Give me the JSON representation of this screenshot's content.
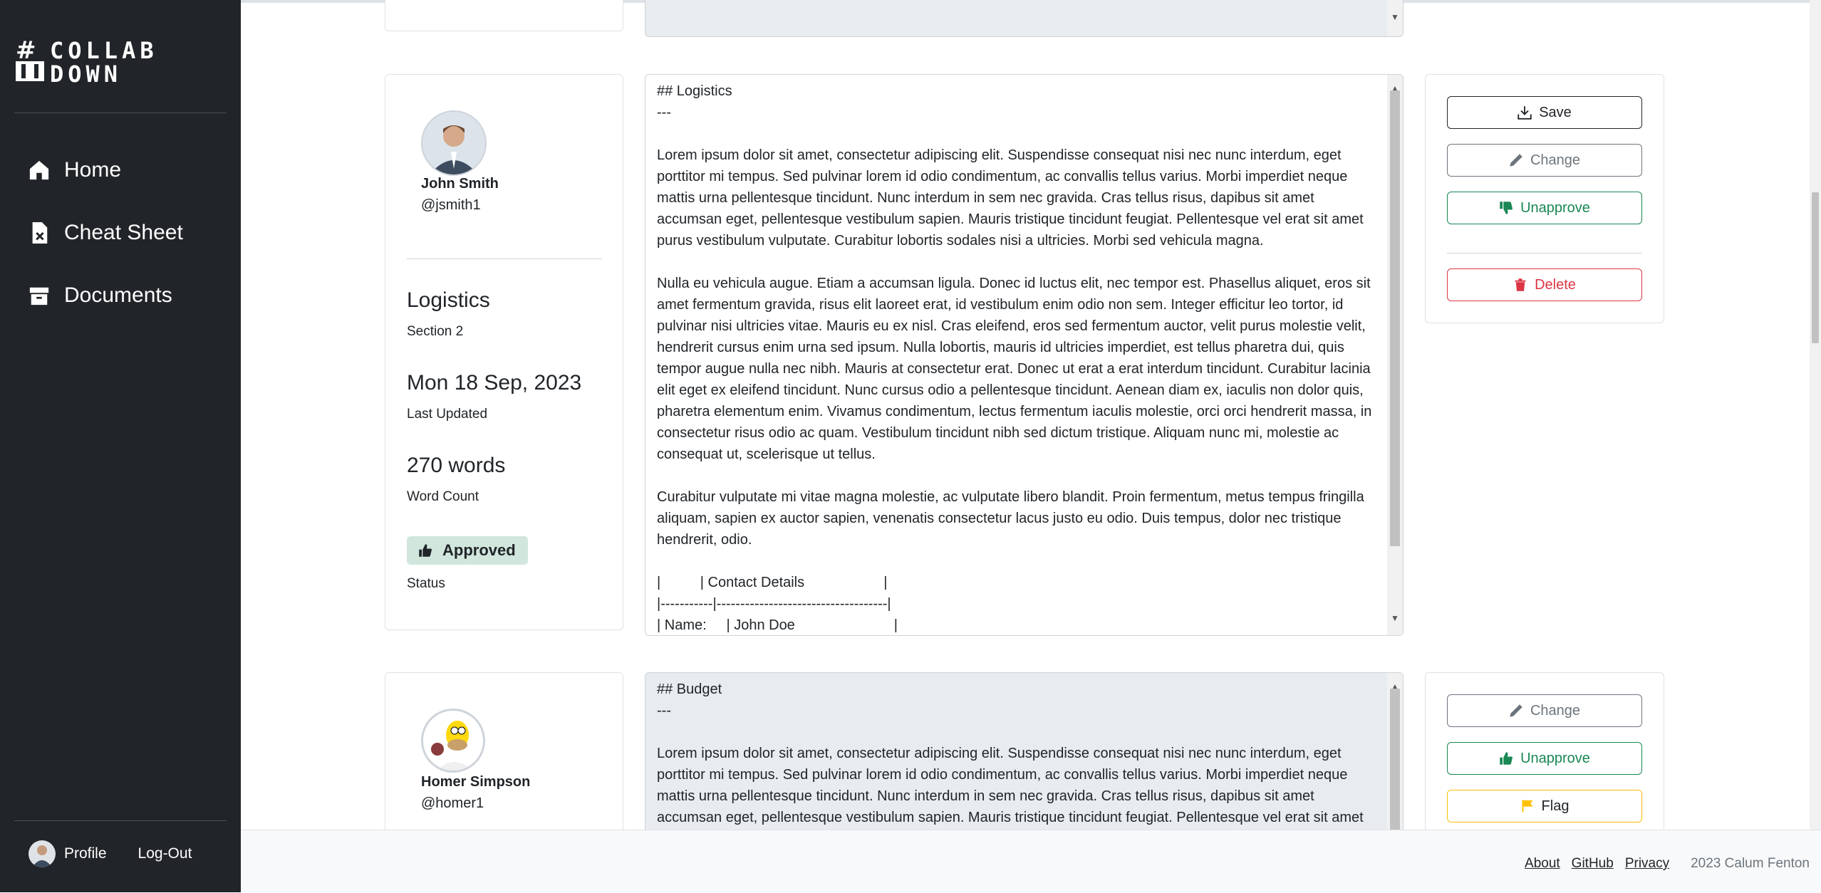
{
  "brand": {
    "logo_text": "#COLLAB DOWN"
  },
  "sidebar": {
    "items": [
      {
        "label": "Home",
        "icon": "home-icon"
      },
      {
        "label": "Cheat Sheet",
        "icon": "file-x-icon"
      },
      {
        "label": "Documents",
        "icon": "archive-icon"
      }
    ],
    "footer": {
      "profile_label": "Profile",
      "logout_label": "Log-Out"
    }
  },
  "sections": [
    {
      "author": {
        "name": "John Smith",
        "handle": "@jsmith1"
      },
      "title": "Logistics",
      "subtitle": "Section 2",
      "date": "Mon 18 Sep, 2023",
      "date_label": "Last Updated",
      "word_count": "270 words",
      "word_count_label": "Word Count",
      "status": "Approved",
      "status_label": "Status",
      "content": "## Logistics\n---\n\nLorem ipsum dolor sit amet, consectetur adipiscing elit. Suspendisse consequat nisi nec nunc interdum, eget porttitor mi tempus. Sed pulvinar lorem id odio condimentum, ac convallis tellus varius. Morbi imperdiet neque mattis urna pellentesque tincidunt. Nunc interdum in sem nec gravida. Cras tellus risus, dapibus sit amet accumsan eget, pellentesque vestibulum sapien. Mauris tristique tincidunt feugiat. Pellentesque vel erat sit amet purus vestibulum vulputate. Curabitur lobortis sodales nisi a ultricies. Morbi sed vehicula magna.\n\nNulla eu vehicula augue. Etiam a accumsan ligula. Donec id luctus elit, nec tempor est. Phasellus aliquet, eros sit amet fermentum gravida, risus elit laoreet erat, id vestibulum enim odio non sem. Integer efficitur leo tortor, id pulvinar nisi ultricies vitae. Mauris eu ex nisl. Cras eleifend, eros sed fermentum auctor, velit purus molestie velit, hendrerit cursus enim urna sed ipsum. Nulla lobortis, mauris id ultricies imperdiet, est tellus pharetra dui, quis tempor augue nulla nec nibh. Mauris at consectetur erat. Donec ut erat a erat interdum tincidunt. Curabitur lacinia elit eget ex eleifend tincidunt. Nunc cursus odio a pellentesque tincidunt. Aenean diam ex, iaculis non dolor quis, pharetra elementum enim. Vivamus condimentum, lectus fermentum iaculis molestie, orci orci hendrerit massa, in consectetur risus odio ac quam. Vestibulum tincidunt nibh sed dictum tristique. Aliquam nunc mi, molestie ac consequat ut, scelerisque ut tellus.\n\nCurabitur vulputate mi vitae magna molestie, ac vulputate libero blandit. Proin fermentum, metus tempus fringilla aliquam, sapien ex auctor sapien, venenatis consectetur lacus justo eu odio. Duis tempus, dolor nec tristique hendrerit, odio.\n\n|          | Contact Details                    |\n|-----------|------------------------------------|\n| Name:     | John Doe                         |",
      "buttons": {
        "save": "Save",
        "change": "Change",
        "unapprove": "Unapprove",
        "delete": "Delete"
      }
    },
    {
      "author": {
        "name": "Homer Simpson",
        "handle": "@homer1"
      },
      "content": "## Budget\n---\n\nLorem ipsum dolor sit amet, consectetur adipiscing elit. Suspendisse consequat nisi nec nunc interdum, eget porttitor mi tempus. Sed pulvinar lorem id odio condimentum, ac convallis tellus varius. Morbi imperdiet neque mattis urna pellentesque tincidunt. Nunc interdum in sem nec gravida. Cras tellus risus, dapibus sit amet accumsan eget, pellentesque vestibulum sapien. Mauris tristique tincidunt feugiat. Pellentesque vel erat sit amet purus",
      "buttons": {
        "change": "Change",
        "unapprove": "Unapprove",
        "flag": "Flag"
      }
    }
  ],
  "footer": {
    "about": "About",
    "github": "GitHub",
    "privacy": "Privacy",
    "copyright": "2023 Calum Fenton"
  },
  "colors": {
    "sidebar_bg": "#212529",
    "success": "#198754",
    "danger": "#dc3545",
    "warning": "#ffc107",
    "secondary": "#6c757d"
  }
}
